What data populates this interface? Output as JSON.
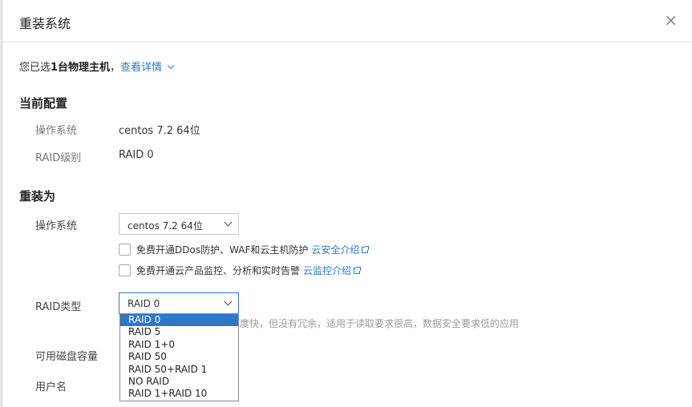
{
  "dialog": {
    "title": "重装系统",
    "close_glyph": "×"
  },
  "selected": {
    "prefix": "您已选",
    "count_text": "1台物理主机",
    "suffix": "，",
    "details_link": "查看详情"
  },
  "current": {
    "heading": "当前配置",
    "os_label": "操作系统",
    "os_value": "centos 7.2 64位",
    "raid_label": "RAID级别",
    "raid_value": "RAID 0"
  },
  "reinstall": {
    "heading": "重装为",
    "os_label": "操作系统",
    "os_select_value": "centos 7.2 64位",
    "ddos_text": "免费开通DDos防护、WAF和云主机防护",
    "ddos_link": "云安全介绍",
    "monitor_text": "免费开通云产品监控、分析和实时告警",
    "monitor_link": "云监控介绍",
    "raid_label": "RAID类型",
    "raid_select_value": "RAID 0",
    "raid_options": [
      "RAID 0",
      "RAID 5",
      "RAID 1+0",
      "RAID 50",
      "RAID 50+RAID 1",
      "NO RAID",
      "RAID 1+RAID 10"
    ],
    "raid_hint": "度快，但没有冗余，适用于读取要求很高，数据安全要求低的应用",
    "disk_label": "可用磁盘容量",
    "user_label": "用户名"
  },
  "colors": {
    "accent": "#2d78c9",
    "muted": "#777777"
  }
}
